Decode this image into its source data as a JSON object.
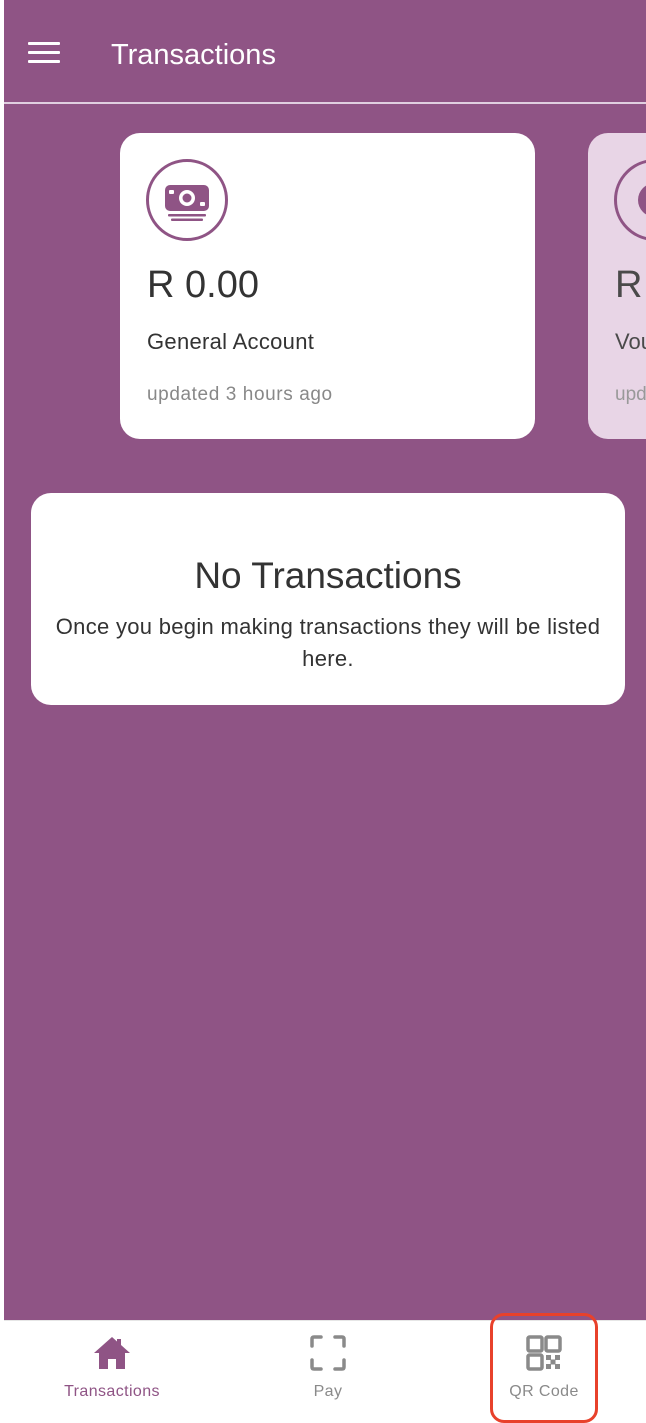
{
  "app_bar": {
    "title": "Transactions",
    "menu_icon": "hamburger-menu-icon"
  },
  "accounts": [
    {
      "icon": "banknote-icon",
      "balance": "R 0.00",
      "name": "General Account",
      "updated": "updated 3 hours ago"
    },
    {
      "icon": "banknote-icon",
      "balance": "R",
      "name": "Vou",
      "updated": "upd"
    }
  ],
  "empty_state": {
    "title": "No Transactions",
    "text": "Once you begin making transactions they will be listed here."
  },
  "bottom_nav": {
    "items": [
      {
        "label": "Transactions",
        "icon": "home-icon",
        "active": true
      },
      {
        "label": "Pay",
        "icon": "scan-frame-icon",
        "active": false
      },
      {
        "label": "QR Code",
        "icon": "qr-code-icon",
        "active": false
      }
    ]
  },
  "colors": {
    "primary": "#8f5485",
    "card_background": "#ffffff",
    "second_card_background": "#e8d5e6",
    "highlight_outline": "#e8412b",
    "inactive_nav": "#8a8a8a"
  }
}
